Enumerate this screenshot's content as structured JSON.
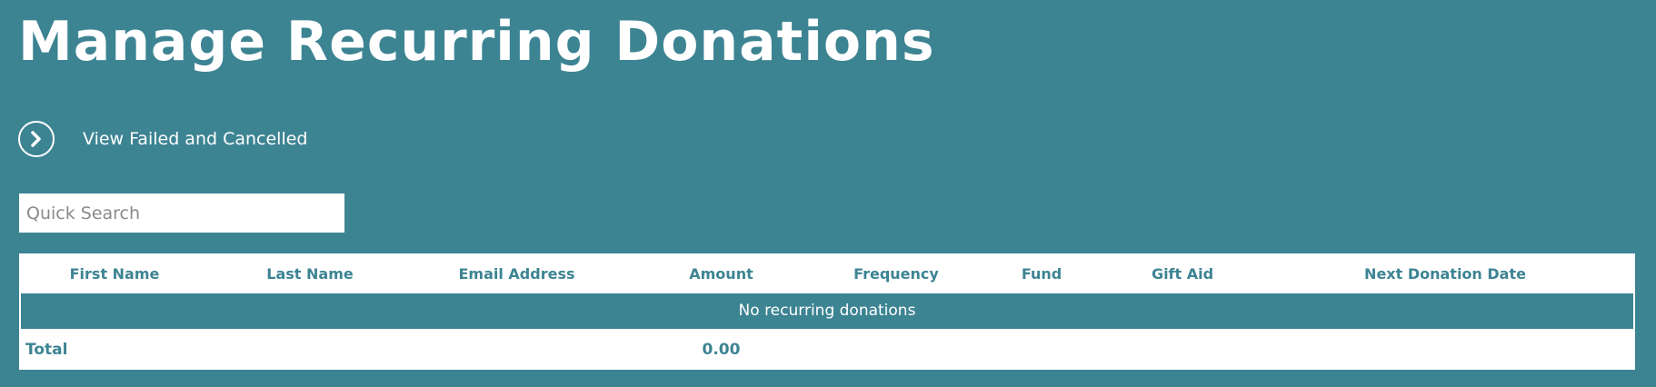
{
  "page": {
    "title": "Manage Recurring Donations"
  },
  "view_failed": {
    "label": "View Failed and Cancelled",
    "icon": "chevron-right-circle-icon"
  },
  "search": {
    "placeholder": "Quick Search",
    "value": ""
  },
  "table": {
    "columns": [
      "First Name",
      "Last Name",
      "Email Address",
      "Amount",
      "Frequency",
      "Fund",
      "Gift Aid",
      "Next Donation Date"
    ],
    "empty_message": "No recurring donations",
    "total_label": "Total",
    "total_amount": "0.00"
  },
  "colors": {
    "background": "#3d8493",
    "panel": "#ffffff",
    "header_text": "#3d8493"
  }
}
